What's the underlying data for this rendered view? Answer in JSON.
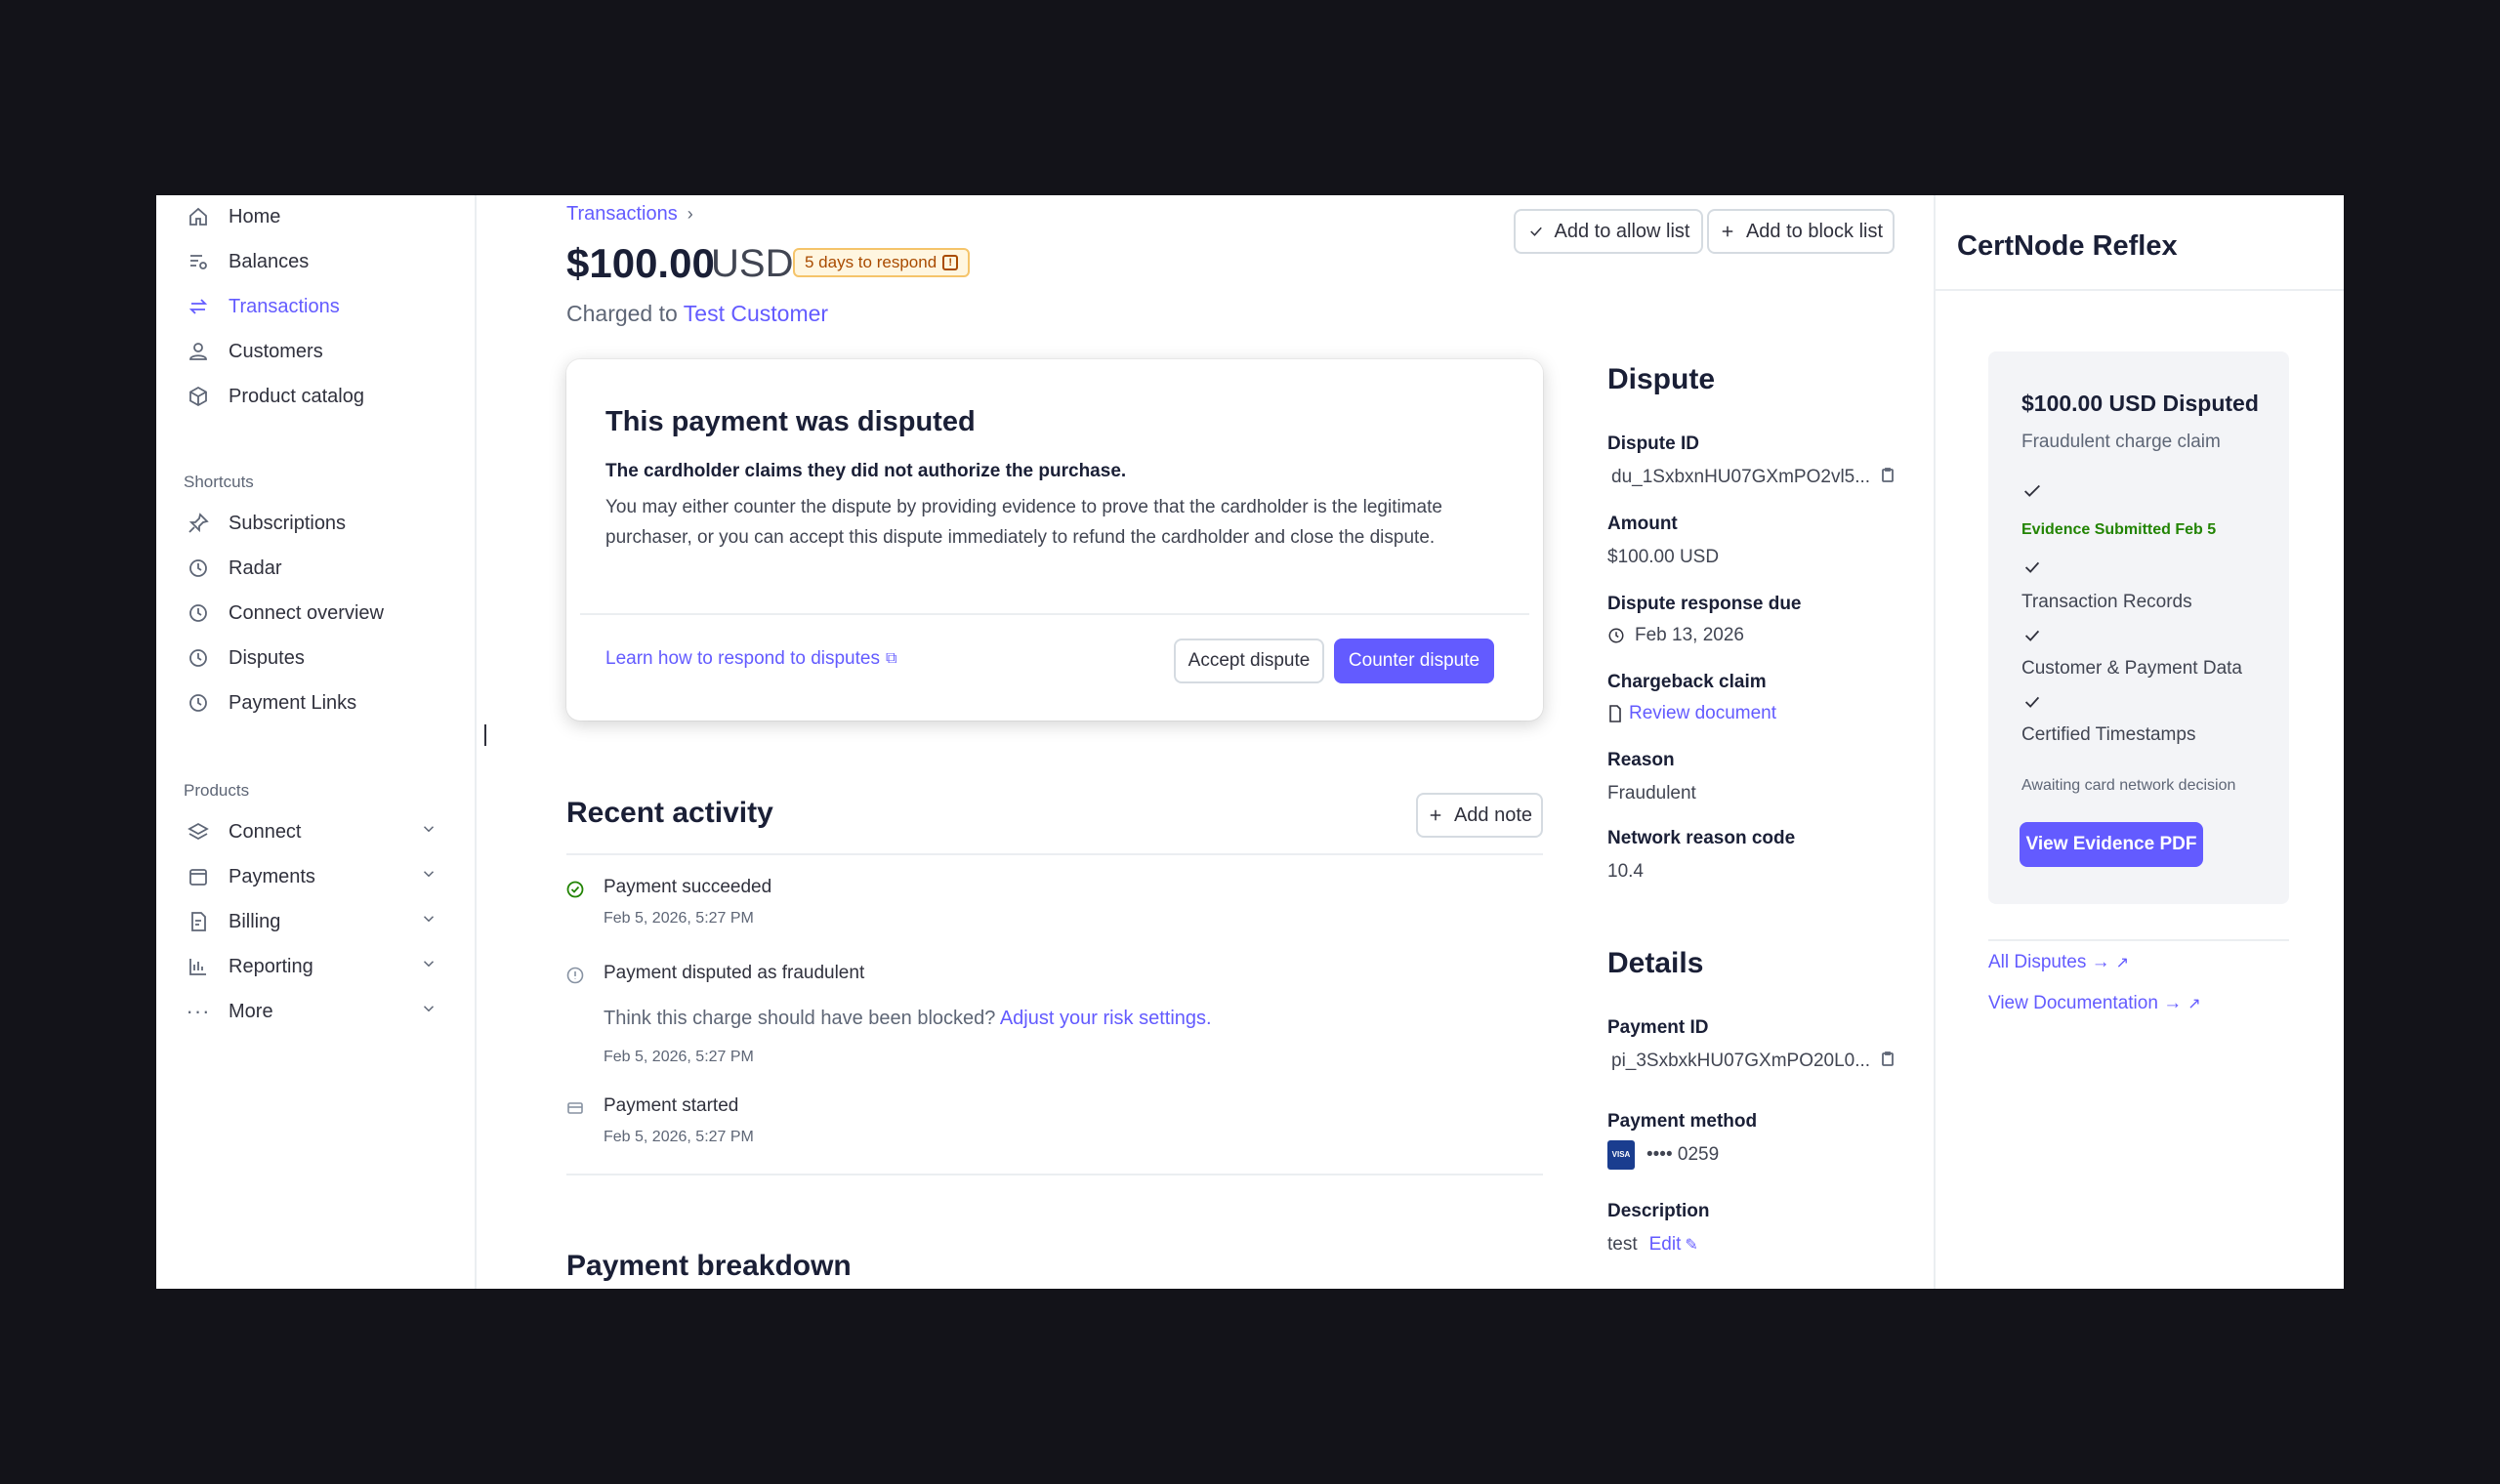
{
  "sidebar": {
    "items": [
      {
        "label": "Home",
        "icon": "home-icon"
      },
      {
        "label": "Balances",
        "icon": "balances-icon"
      },
      {
        "label": "Transactions",
        "icon": "transactions-icon",
        "active": true
      },
      {
        "label": "Customers",
        "icon": "customers-icon"
      },
      {
        "label": "Product catalog",
        "icon": "product-catalog-icon"
      }
    ],
    "shortcuts_label": "Shortcuts",
    "shortcuts": [
      {
        "label": "Subscriptions",
        "icon": "pin-icon"
      },
      {
        "label": "Radar",
        "icon": "clock-icon"
      },
      {
        "label": "Connect overview",
        "icon": "clock-icon"
      },
      {
        "label": "Disputes",
        "icon": "clock-icon"
      },
      {
        "label": "Payment Links",
        "icon": "clock-icon"
      }
    ],
    "products_label": "Products",
    "products": [
      {
        "label": "Connect",
        "icon": "connect-icon"
      },
      {
        "label": "Payments",
        "icon": "payments-icon"
      },
      {
        "label": "Billing",
        "icon": "billing-icon"
      },
      {
        "label": "Reporting",
        "icon": "reporting-icon"
      },
      {
        "label": "More",
        "icon": "more-icon"
      }
    ]
  },
  "header": {
    "breadcrumb": "Transactions",
    "amount": "$100.00",
    "currency": "USD",
    "badge": "5 days to respond",
    "charged_prefix": "Charged to",
    "customer": "Test Customer",
    "allow_list": "Add to allow list",
    "block_list": "Add to block list"
  },
  "dispute_card": {
    "title": "This payment was disputed",
    "subtitle": "The cardholder claims they did not authorize the purchase.",
    "body": "You may either counter the dispute by providing evidence to prove that the cardholder is the legitimate purchaser, or you can accept this dispute immediately to refund the cardholder and close the dispute.",
    "learn_link": "Learn how to respond to disputes",
    "accept": "Accept dispute",
    "counter": "Counter dispute"
  },
  "activity": {
    "title": "Recent activity",
    "add_note": "Add note",
    "events": [
      {
        "title": "Payment succeeded",
        "time": "Feb 5, 2026, 5:27 PM"
      },
      {
        "title": "Payment disputed as fraudulent",
        "note": "Think this charge should have been blocked?",
        "note_link": "Adjust your risk settings.",
        "time": "Feb 5, 2026, 5:27 PM"
      },
      {
        "title": "Payment started",
        "time": "Feb 5, 2026, 5:27 PM"
      }
    ]
  },
  "breakdown": {
    "title": "Payment breakdown"
  },
  "dispute_info": {
    "title": "Dispute",
    "id_label": "Dispute ID",
    "id_value": "du_1SxbxnHU07GXmPO2vl5...",
    "amount_label": "Amount",
    "amount_value": "$100.00 USD",
    "due_label": "Dispute response due",
    "due_value": "Feb 13, 2026",
    "claim_label": "Chargeback claim",
    "claim_value": "Review document",
    "reason_label": "Reason",
    "reason_value": "Fraudulent",
    "code_label": "Network reason code",
    "code_value": "10.4"
  },
  "details": {
    "title": "Details",
    "payment_id_label": "Payment ID",
    "payment_id_value": "pi_3SxbxkHU07GXmPO20L0...",
    "method_label": "Payment method",
    "card_brand": "VISA",
    "card_last4": "•••• 0259",
    "description_label": "Description",
    "description_value": "test",
    "edit": "Edit"
  },
  "reflex": {
    "title": "CertNode Reflex",
    "card_title": "$100.00 USD Disputed",
    "card_sub": "Fraudulent charge claim",
    "evidence": "Evidence Submitted Feb 5",
    "items": [
      "Transaction Records",
      "Customer & Payment Data",
      "Certified Timestamps"
    ],
    "status": "Awaiting card network decision",
    "view_pdf": "View Evidence PDF",
    "all_disputes": "All Disputes →",
    "docs": "View Documentation →"
  },
  "colors": {
    "accent": "#635bff",
    "success": "#228403",
    "warning_bg": "#fff6e0"
  }
}
